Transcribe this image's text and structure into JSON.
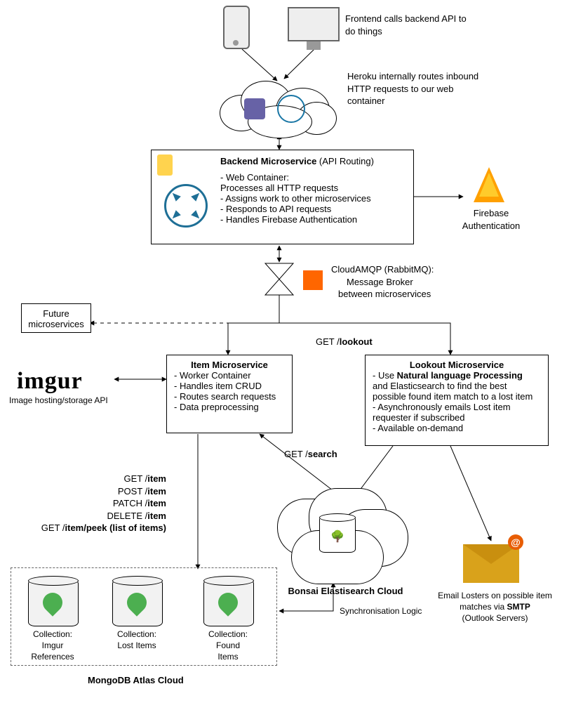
{
  "frontend": {
    "text": "Frontend calls backend API to do things"
  },
  "heroku": {
    "text": "Heroku internally routes inbound HTTP requests to our web container"
  },
  "backend": {
    "title": "Backend Microservice",
    "title_suffix": "(API Routing)",
    "line1": "- Web Container:",
    "line1b": "  Processes all HTTP requests",
    "line2": "- Assigns work to other microservices",
    "line3": "- Responds to API requests",
    "line4": "- Handles Firebase Authentication"
  },
  "firebase": {
    "label": "Firebase Authentication"
  },
  "amqp": {
    "line1": "CloudAMQP (RabbitMQ):",
    "line2": "Message Broker",
    "line3": "between microservices"
  },
  "future": {
    "label": "Future microservices"
  },
  "lookout_edge": {
    "prefix": "GET /",
    "bold": "lookout"
  },
  "item": {
    "title": "Item Microservice",
    "l1": "- Worker Container",
    "l2": "- Handles item CRUD",
    "l3": "- Routes search requests",
    "l4": "- Data preprocessing"
  },
  "lookout": {
    "title": "Lookout Microservice",
    "l1a": "- Use ",
    "l1b": "Natural language Processing",
    "l2": "and Elasticsearch to find the best",
    "l3": "possible found item match to a lost item",
    "l4": "- Asynchronously emails Lost item",
    "l5": "requester if subscribed",
    "l6": "- Available on-demand"
  },
  "imgur": {
    "name": "imgur",
    "caption": "Image hosting/storage API"
  },
  "search_edge": {
    "prefix": "GET /",
    "bold": "search"
  },
  "crud": {
    "l1a": "GET /",
    "l1b": "item",
    "l2a": "POST /",
    "l2b": "item",
    "l3a": "PATCH /",
    "l3b": "item",
    "l4a": "DELETE /",
    "l4b": "item",
    "l5a": "GET /",
    "l5b": "item/peek (list of items)"
  },
  "bonsai": {
    "label": "Bonsai Elastisearch Cloud"
  },
  "sync": {
    "label": "Synchronisation Logic"
  },
  "smtp": {
    "l1": "Email Losters on possible item",
    "l2a": "matches via ",
    "l2b": "SMTP",
    "l3": "(Outlook Servers)"
  },
  "mongo": {
    "c1a": "Collection:",
    "c1b": "Imgur",
    "c1c": "References",
    "c2a": "Collection:",
    "c2b": "Lost Items",
    "c3a": "Collection:",
    "c3b": "Found",
    "c3c": "Items",
    "title": "MongoDB Atlas Cloud"
  }
}
